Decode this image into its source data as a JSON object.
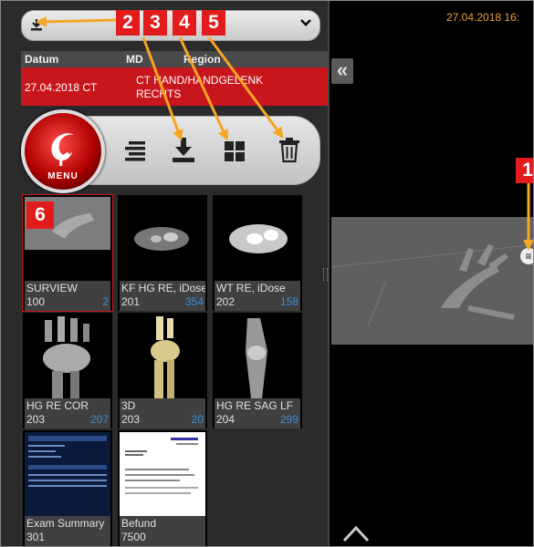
{
  "topbar": {
    "download_icon": "download-icon",
    "dropdown_icon": "chevron-down-icon"
  },
  "study_table": {
    "headers": [
      "Datum",
      "MD",
      "Region"
    ],
    "row": {
      "date_modality": "27.04.2018  CT",
      "region_line1": "CT HAND/HANDGELENK",
      "region_line2": "RECHTS"
    }
  },
  "toolbar": {
    "menu_label": "MENU",
    "icons": [
      "list-icon",
      "download-icon",
      "grid-icon",
      "trash-icon"
    ]
  },
  "series": [
    {
      "name": "SURVIEW",
      "number": "100",
      "count": "2"
    },
    {
      "name": "KF HG RE, iDose",
      "number": "201",
      "count": "354"
    },
    {
      "name": "WT RE, iDose",
      "number": "202",
      "count": "158"
    },
    {
      "name": "HG RE COR",
      "number": "203",
      "count": "207"
    },
    {
      "name": "3D",
      "number": "203",
      "count": "20"
    },
    {
      "name": "HG RE SAG LF",
      "number": "204",
      "count": "299"
    },
    {
      "name": "Exam Summary",
      "number": "301",
      "count": ""
    },
    {
      "name": "Befund",
      "number": "7500",
      "count": ""
    }
  ],
  "viewer": {
    "date_text": "27.04.2018 16:",
    "collapse_label": "«"
  },
  "annotations": [
    "1",
    "2",
    "3",
    "4",
    "5",
    "6"
  ],
  "colors": {
    "accent_red": "#c8161d",
    "callout_orange": "#f5a623",
    "count_blue": "#3a8fd8",
    "date_orange": "#e8a030"
  }
}
